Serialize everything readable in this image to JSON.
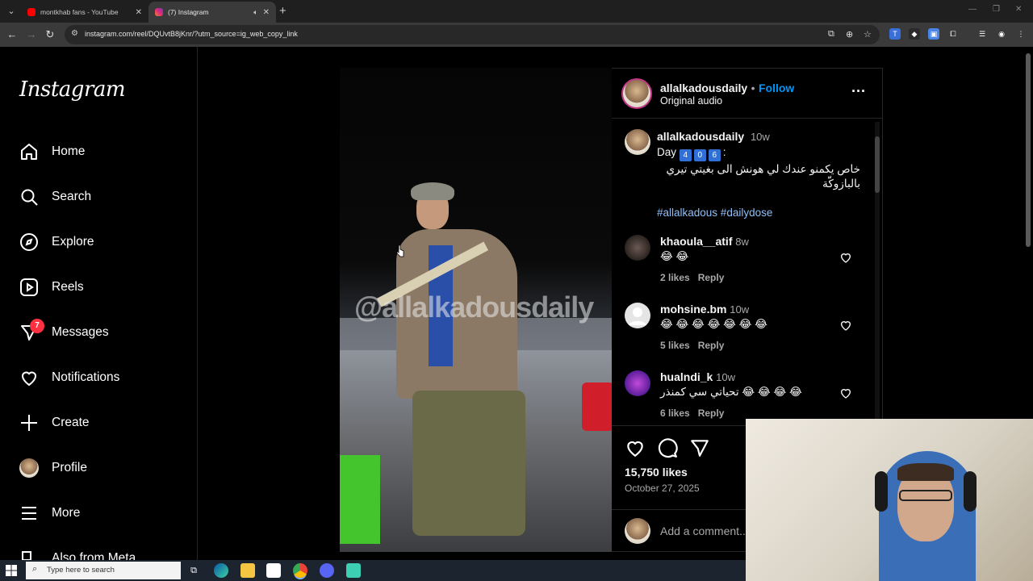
{
  "browser": {
    "tabs": [
      {
        "title": "montkhab fans - YouTube",
        "favicon_color": "#ff0000"
      },
      {
        "title": "(7) Instagram",
        "favicon_color": "#e1306c"
      }
    ],
    "url": "instagram.com/reel/DQUvtB8jKnr/?utm_source=ig_web_copy_link"
  },
  "sidebar": {
    "logo": "Instagram",
    "items": [
      {
        "label": "Home",
        "icon": "home-icon"
      },
      {
        "label": "Search",
        "icon": "search-icon"
      },
      {
        "label": "Explore",
        "icon": "compass-icon"
      },
      {
        "label": "Reels",
        "icon": "reels-icon"
      },
      {
        "label": "Messages",
        "icon": "messenger-icon"
      },
      {
        "label": "Notifications",
        "icon": "heart-icon"
      },
      {
        "label": "Create",
        "icon": "plus-icon"
      },
      {
        "label": "Profile",
        "icon": "avatar"
      },
      {
        "label": "More",
        "icon": "menu-icon"
      },
      {
        "label": "Also from Meta",
        "icon": "meta-icon"
      }
    ],
    "messages_badge": "7"
  },
  "reel": {
    "watermark": "@allalkadousdaily"
  },
  "post": {
    "author": "allalkadousdaily",
    "dot": "•",
    "follow": "Follow",
    "audio": "Original audio",
    "more": "···",
    "caption": {
      "author": "allalkadousdaily",
      "age": "10w",
      "day_prefix": "Day",
      "day_digits": [
        "4",
        "0",
        "6"
      ],
      "day_suffix": ":",
      "arabic": "خاص يكمنو عندك لي هونش الى بغيتي تيري بالبازوكّة",
      "hashtags": "#allalkadous #dailydose"
    },
    "comments": [
      {
        "user": "khaoula__atif",
        "age": "8w",
        "text": "😂 😂",
        "likes": "2 likes",
        "reply": "Reply"
      },
      {
        "user": "mohsine.bm",
        "age": "10w",
        "text": "😂 😂 😂 😂 😂 😂 😂",
        "likes": "5 likes",
        "reply": "Reply"
      },
      {
        "user": "hualndi_k",
        "age": "10w",
        "text": "تحياتي سي كمنذر 😂 😂 😂 😂",
        "likes": "6 likes",
        "reply": "Reply"
      }
    ],
    "likes": "15,750 likes",
    "date": "October 27, 2025",
    "add_comment_placeholder": "Add a comment..."
  },
  "taskbar": {
    "search_placeholder": "Type here to search"
  },
  "colors": {
    "accent_blue": "#0095f6",
    "badge_red": "#ff3040",
    "background": "#000000"
  }
}
